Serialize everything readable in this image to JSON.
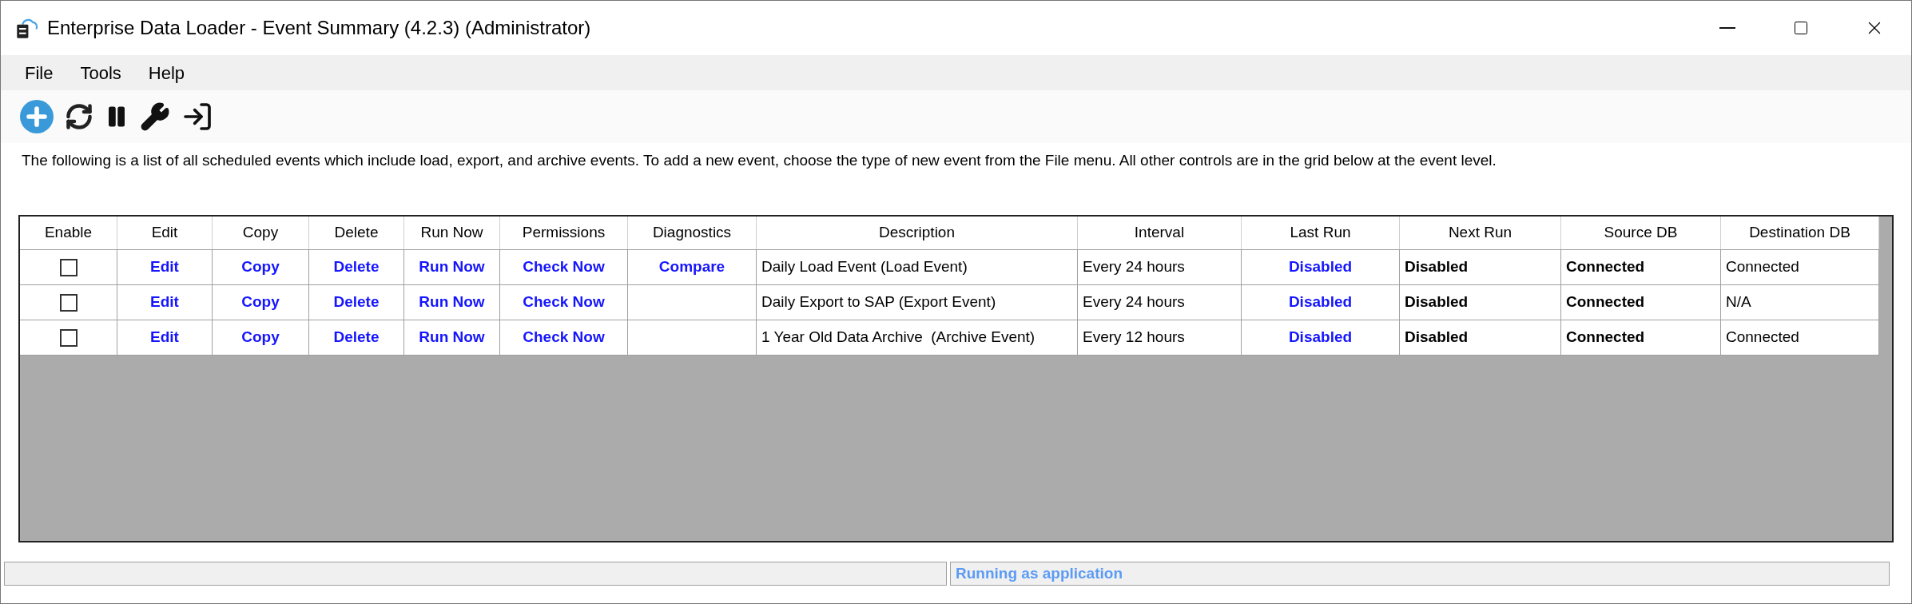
{
  "window": {
    "title": "Enterprise Data Loader - Event Summary (4.2.3) (Administrator)"
  },
  "menu": [
    {
      "label": "File"
    },
    {
      "label": "Tools"
    },
    {
      "label": "Help"
    }
  ],
  "description": "The following is a list of all scheduled events which include load, export, and archive events. To add a new event, choose the type of new event from the File menu. All other controls are in the grid below at the event level.",
  "table": {
    "columns": [
      "Enable",
      "Edit",
      "Copy",
      "Delete",
      "Run Now",
      "Permissions",
      "Diagnostics",
      "Description",
      "Interval",
      "Last Run",
      "Next Run",
      "Source DB",
      "Destination DB"
    ],
    "rows": [
      {
        "cells": [
          {
            "kind": "checkbox",
            "checked": false
          },
          {
            "kind": "link",
            "text": "Edit"
          },
          {
            "kind": "link",
            "text": "Copy"
          },
          {
            "kind": "link",
            "text": "Delete"
          },
          {
            "kind": "link",
            "text": "Run Now"
          },
          {
            "kind": "link",
            "text": "Check Now"
          },
          {
            "kind": "link",
            "text": "Compare"
          },
          {
            "kind": "text",
            "text": "Daily Load Event (Load Event)"
          },
          {
            "kind": "text",
            "text": "Every 24 hours"
          },
          {
            "kind": "link",
            "text": "Disabled"
          },
          {
            "kind": "bold",
            "text": "Disabled"
          },
          {
            "kind": "bold",
            "text": "Connected"
          },
          {
            "kind": "text",
            "text": "Connected"
          }
        ]
      },
      {
        "cells": [
          {
            "kind": "checkbox",
            "checked": false
          },
          {
            "kind": "link",
            "text": "Edit"
          },
          {
            "kind": "link",
            "text": "Copy"
          },
          {
            "kind": "link",
            "text": "Delete"
          },
          {
            "kind": "link",
            "text": "Run Now"
          },
          {
            "kind": "link",
            "text": "Check Now"
          },
          {
            "kind": "empty"
          },
          {
            "kind": "text",
            "text": "Daily Export to SAP (Export Event)"
          },
          {
            "kind": "text",
            "text": "Every 24 hours"
          },
          {
            "kind": "link",
            "text": "Disabled"
          },
          {
            "kind": "bold",
            "text": "Disabled"
          },
          {
            "kind": "bold",
            "text": "Connected"
          },
          {
            "kind": "text",
            "text": "N/A"
          }
        ]
      },
      {
        "cells": [
          {
            "kind": "checkbox",
            "checked": false
          },
          {
            "kind": "link",
            "text": "Edit"
          },
          {
            "kind": "link",
            "text": "Copy"
          },
          {
            "kind": "link",
            "text": "Delete"
          },
          {
            "kind": "link",
            "text": "Run Now"
          },
          {
            "kind": "link",
            "text": "Check Now"
          },
          {
            "kind": "empty"
          },
          {
            "kind": "text",
            "text": "1 Year Old Data Archive  (Archive Event)"
          },
          {
            "kind": "text",
            "text": "Every 12 hours"
          },
          {
            "kind": "link",
            "text": "Disabled"
          },
          {
            "kind": "bold",
            "text": "Disabled"
          },
          {
            "kind": "bold",
            "text": "Connected"
          },
          {
            "kind": "text",
            "text": "Connected"
          }
        ]
      }
    ]
  },
  "status_bar": {
    "panel_2": "Running as application"
  }
}
